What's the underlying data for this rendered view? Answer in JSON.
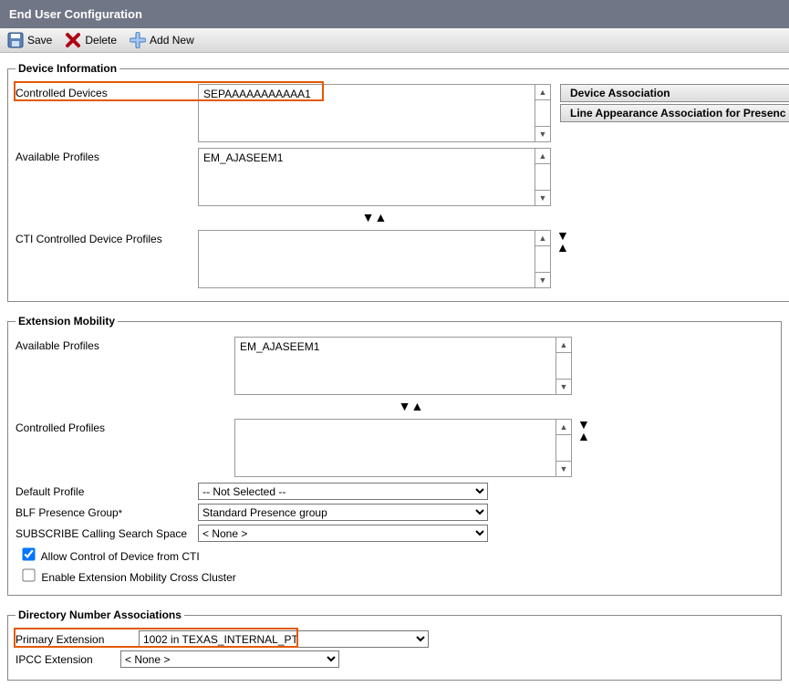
{
  "header": {
    "title": "End User Configuration"
  },
  "toolbar": {
    "save": "Save",
    "delete": "Delete",
    "addnew": "Add New"
  },
  "deviceInfo": {
    "legend": "Device Information",
    "controlledDevicesLabel": "Controlled Devices",
    "controlledDevicesItem": "SEPAAAAAAAAAAA1",
    "availableProfilesLabel": "Available Profiles",
    "availableProfilesItem": "EM_AJASEEM1",
    "ctiLabel": "CTI Controlled Device Profiles",
    "btnDeviceAssoc": "Device Association",
    "btnLineAppearance": "Line Appearance Association for Presenc"
  },
  "extMobility": {
    "legend": "Extension Mobility",
    "availableProfilesLabel": "Available Profiles",
    "availableProfilesItem": "EM_AJASEEM1",
    "controlledProfilesLabel": "Controlled Profiles",
    "defaultProfileLabel": "Default Profile",
    "defaultProfileValue": "-- Not Selected --",
    "blfLabel": "BLF Presence Group",
    "blfValue": "Standard Presence group",
    "subscribeCssLabel": "SUBSCRIBE Calling Search Space",
    "subscribeCssValue": "< None >",
    "allowCti": "Allow Control of Device from CTI",
    "enableEmcc": "Enable Extension Mobility Cross Cluster"
  },
  "dnAssoc": {
    "legend": "Directory Number Associations",
    "primaryLabel": "Primary Extension",
    "primaryValue": "1002 in TEXAS_INTERNAL_PT",
    "ipccLabel": "IPCC Extension",
    "ipccValue": "< None >"
  }
}
